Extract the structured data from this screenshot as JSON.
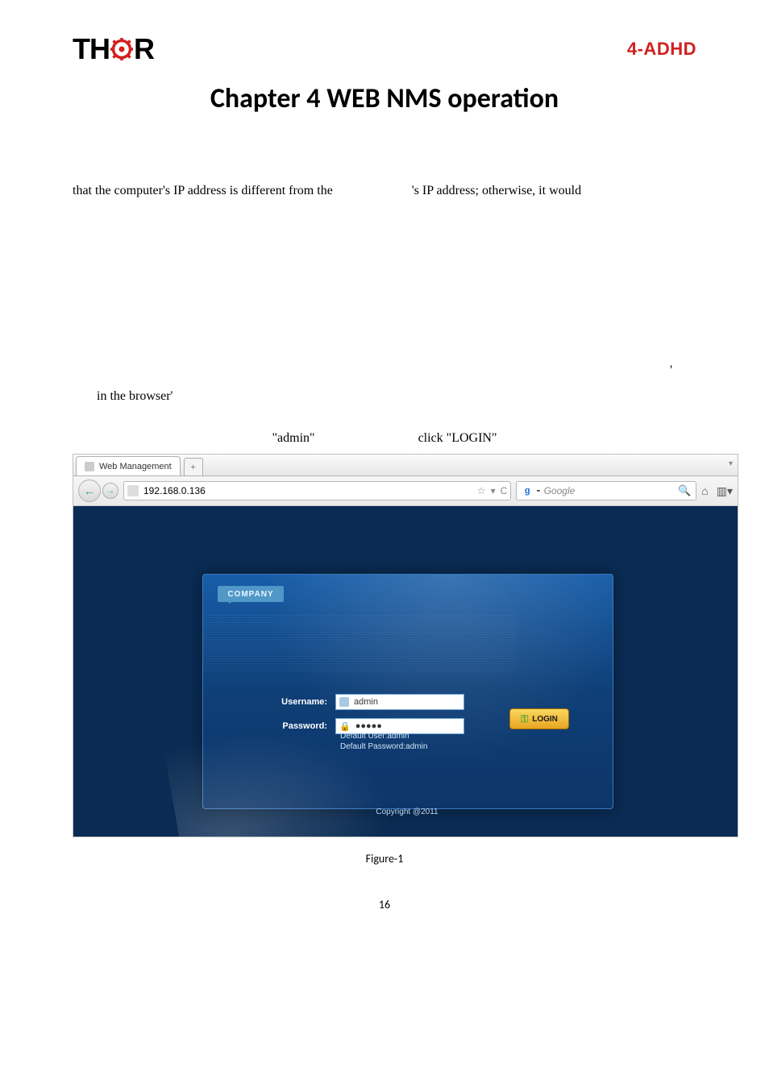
{
  "header": {
    "logo_left": "TH",
    "logo_right": "R",
    "model": "4-ADHD"
  },
  "chapter_title": "Chapter 4 WEB NMS operation",
  "body_line_left": "that the computer's IP address is different from the",
  "body_line_right": "'s IP address; otherwise, it would",
  "apostrophe": "'",
  "browser_line": "in the browser'",
  "admin_word": "\"admin\"",
  "login_word": "click \"LOGIN\"",
  "browser": {
    "tab_title": "Web Management",
    "newtab": "+",
    "address": "192.168.0.136",
    "star": "☆",
    "dropdown": "▾",
    "reload": "C",
    "search_placeholder": "Google",
    "search_prefix_dash": "-",
    "magnifier": "🔍",
    "home": "⌂",
    "menu": "▾"
  },
  "login": {
    "ribbon": "COMPANY",
    "username_label": "Username:",
    "username_value": "admin",
    "password_label": "Password:",
    "password_value": "●●●●●",
    "default_user": "Default User:admin",
    "default_pw": "Default Password:admin",
    "login_btn": "LOGIN",
    "key_icon": "⚿"
  },
  "copyright": "Copyright @2011",
  "figure_caption": "Figure-1",
  "page_number": "16"
}
